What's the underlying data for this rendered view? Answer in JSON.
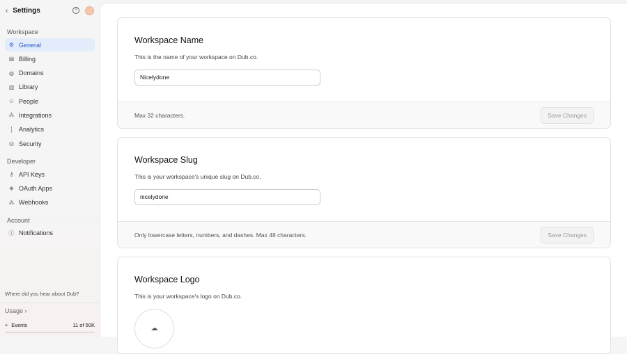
{
  "header": {
    "title": "Settings"
  },
  "sidebar": {
    "sections": [
      {
        "label": "Workspace",
        "items": [
          {
            "label": "General",
            "icon": "gear"
          },
          {
            "label": "Billing",
            "icon": "receipt"
          },
          {
            "label": "Domains",
            "icon": "globe"
          },
          {
            "label": "Library",
            "icon": "library"
          },
          {
            "label": "People",
            "icon": "users"
          },
          {
            "label": "Integrations",
            "icon": "integrations"
          },
          {
            "label": "Analytics",
            "icon": "chart"
          },
          {
            "label": "Security",
            "icon": "shield"
          }
        ]
      },
      {
        "label": "Developer",
        "items": [
          {
            "label": "API Keys",
            "icon": "key"
          },
          {
            "label": "OAuth Apps",
            "icon": "cube"
          },
          {
            "label": "Webhooks",
            "icon": "webhook"
          }
        ]
      },
      {
        "label": "Account",
        "items": [
          {
            "label": "Notifications",
            "icon": "info"
          }
        ]
      }
    ],
    "hear": "Where did you hear about Dub?",
    "usage": "Usage",
    "events_label": "Events",
    "events_value": "11 of 50K",
    "events_fraction": 0.0002
  },
  "cards": {
    "name": {
      "title": "Workspace Name",
      "desc": "This is the name of your workspace on Dub.co.",
      "value": "Nicelydone",
      "hint": "Max 32 characters.",
      "button": "Save Changes"
    },
    "slug": {
      "title": "Workspace Slug",
      "desc": "This is your workspace's unique slug on Dub.co.",
      "value": "nicelydone",
      "hint": "Only lowercase letters, numbers, and dashes. Max 48 characters.",
      "button": "Save Changes"
    },
    "logo": {
      "title": "Workspace Logo",
      "desc": "This is your workspace's logo on Dub.co."
    }
  }
}
